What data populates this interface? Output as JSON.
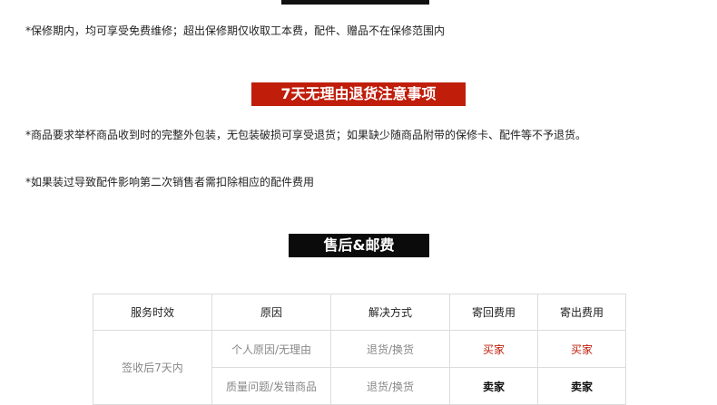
{
  "warranty_note": "*保修期内，均可享受免费维修；超出保修期仅收取工本费，配件、赠品不在保修范围内",
  "return_heading": "7天无理由退货注意事项",
  "return_notes": [
    "*商品要求举杯商品收到时的完整外包装，无包装破损可享受退货；如果缺少随商品附带的保修卡、配件等不予退货。",
    "*如果装过导致配件影响第二次销售者需扣除相应的配件费用"
  ],
  "aftersale_heading": "售后&邮费",
  "table": {
    "headers": [
      "服务时效",
      "原因",
      "解决方式",
      "寄回费用",
      "寄出费用"
    ],
    "period": "签收后7天内",
    "rows": [
      {
        "reason": "个人原因/无理由",
        "solution": "退货/换货",
        "return_fee": "买家",
        "send_fee": "买家"
      },
      {
        "reason": "质量问题/发错商品",
        "solution": "退货/换货",
        "return_fee": "卖家",
        "send_fee": "卖家"
      }
    ]
  },
  "colors": {
    "accent_red": "#c01d0b",
    "heading_black": "#0b0b0b",
    "border": "#dcdcdc"
  }
}
